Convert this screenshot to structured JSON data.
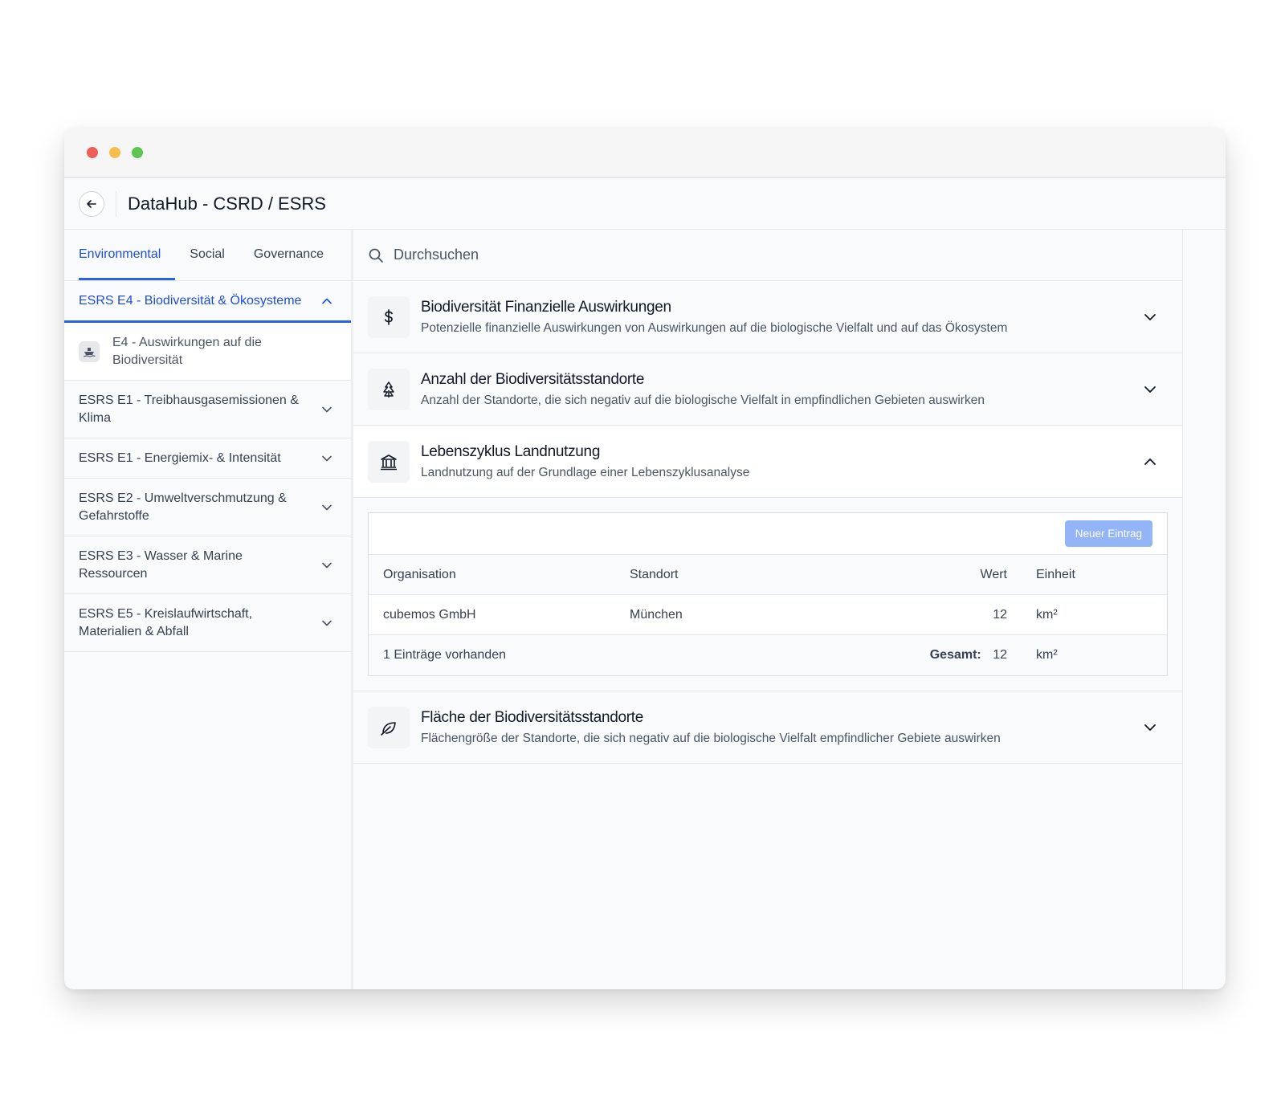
{
  "app": {
    "title": "DataHub - CSRD / ESRS"
  },
  "tabs": [
    {
      "label": "Environmental",
      "active": true
    },
    {
      "label": "Social",
      "active": false
    },
    {
      "label": "Governance",
      "active": false
    }
  ],
  "sidebar": {
    "active_section": "ESRS E4 - Biodiversität & Ökosysteme",
    "active_sub_item": "E4 - Auswirkungen auf die Biodiversität",
    "items": [
      {
        "label": "ESRS E1 - Treibhausgasemissionen & Klima"
      },
      {
        "label": "ESRS E1 - Energiemix- & Intensität"
      },
      {
        "label": "ESRS E2 - Umweltverschmutzung & Gefahrstoffe"
      },
      {
        "label": "ESRS E3 - Wasser & Marine Ressourcen"
      },
      {
        "label": "ESRS E5 - Kreislaufwirtschaft, Materialien & Abfall"
      }
    ]
  },
  "search": {
    "placeholder": "Durchsuchen"
  },
  "accordions": [
    {
      "icon": "dollar-icon",
      "title": "Biodiversität Finanzielle Auswirkungen",
      "description": "Potenzielle finanzielle Auswirkungen von Auswirkungen auf die biologische Vielfalt und auf das Ökosystem",
      "open": false
    },
    {
      "icon": "tree-icon",
      "title": "Anzahl der Biodiversitätsstandorte",
      "description": "Anzahl der Standorte, die sich negativ auf die biologische Vielfalt in empfindlichen Gebieten auswirken",
      "open": false
    },
    {
      "icon": "bank-icon",
      "title": "Lebenszyklus Landnutzung",
      "description": "Landnutzung auf der Grundlage einer Lebenszyklusanalyse",
      "open": true
    },
    {
      "icon": "leaf-icon",
      "title": "Fläche der Biodiversitätsstandorte",
      "description": "Flächengröße der Standorte, die sich negativ auf die biologische Vielfalt empfindlicher Gebiete auswirken",
      "open": false
    }
  ],
  "table": {
    "new_button": "Neuer Eintrag",
    "columns": [
      "Organisation",
      "Standort",
      "Wert",
      "Einheit"
    ],
    "rows": [
      {
        "organisation": "cubemos GmbH",
        "standort": "München",
        "wert": "12",
        "einheit": "km²"
      }
    ],
    "footer": {
      "count_text": "1 Einträge vorhanden",
      "total_label": "Gesamt:",
      "total_value": "12",
      "total_unit": "km²"
    }
  },
  "colors": {
    "accent": "#2563eb",
    "button_disabled": "#93b4f6"
  }
}
